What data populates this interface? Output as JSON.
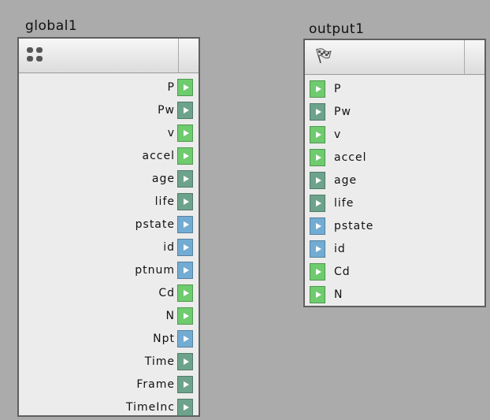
{
  "global_node": {
    "title": "global1",
    "icon": "globals-dots-icon",
    "outputs": [
      {
        "label": "P",
        "color": "green"
      },
      {
        "label": "Pw",
        "color": "teal"
      },
      {
        "label": "v",
        "color": "green"
      },
      {
        "label": "accel",
        "color": "green"
      },
      {
        "label": "age",
        "color": "teal"
      },
      {
        "label": "life",
        "color": "teal"
      },
      {
        "label": "pstate",
        "color": "blue"
      },
      {
        "label": "id",
        "color": "blue"
      },
      {
        "label": "ptnum",
        "color": "blue"
      },
      {
        "label": "Cd",
        "color": "green"
      },
      {
        "label": "N",
        "color": "green"
      },
      {
        "label": "Npt",
        "color": "blue"
      },
      {
        "label": "Time",
        "color": "teal"
      },
      {
        "label": "Frame",
        "color": "teal"
      },
      {
        "label": "TimeInc",
        "color": "teal"
      }
    ]
  },
  "output_node": {
    "title": "output1",
    "icon": "checkered-flag-icon",
    "inputs": [
      {
        "label": "P",
        "color": "green"
      },
      {
        "label": "Pw",
        "color": "teal"
      },
      {
        "label": "v",
        "color": "green"
      },
      {
        "label": "accel",
        "color": "green"
      },
      {
        "label": "age",
        "color": "teal"
      },
      {
        "label": "life",
        "color": "teal"
      },
      {
        "label": "pstate",
        "color": "blue"
      },
      {
        "label": "id",
        "color": "blue"
      },
      {
        "label": "Cd",
        "color": "green"
      },
      {
        "label": "N",
        "color": "green"
      }
    ]
  },
  "colors": {
    "green": "#6ecb6e",
    "teal": "#6da38c",
    "blue": "#73acd3",
    "background": "#ababab",
    "node_body": "#ececec"
  }
}
